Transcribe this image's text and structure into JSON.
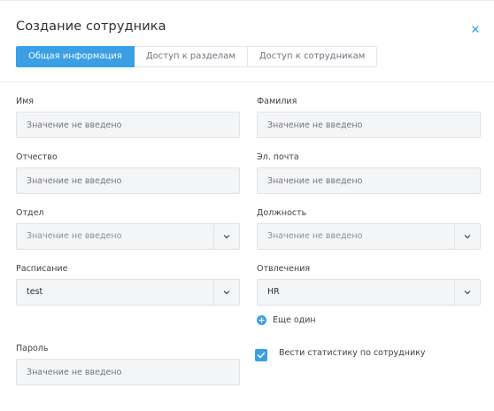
{
  "dialog": {
    "title": "Создание сотрудника",
    "close_icon": "close-icon"
  },
  "tabs": [
    {
      "label": "Общая информация",
      "active": true
    },
    {
      "label": "Доступ к разделам",
      "active": false
    },
    {
      "label": "Доступ к сотрудникам",
      "active": false
    }
  ],
  "form": {
    "first_name": {
      "label": "Имя",
      "placeholder": "Значение не введено",
      "value": ""
    },
    "last_name": {
      "label": "Фамилия",
      "placeholder": "Значение не введено",
      "value": ""
    },
    "middle_name": {
      "label": "Отчество",
      "placeholder": "Значение не введено",
      "value": ""
    },
    "email": {
      "label": "Эл. почта",
      "placeholder": "Значение не введено",
      "value": ""
    },
    "department": {
      "label": "Отдел",
      "display": "Значение не введено"
    },
    "position": {
      "label": "Должность",
      "display": "Значение не введено"
    },
    "schedule": {
      "label": "Расписание",
      "display": "test"
    },
    "distractions": {
      "label": "Отвлечения",
      "display": "HR"
    },
    "add_one": {
      "label": "Еще один"
    },
    "password": {
      "label": "Пароль",
      "placeholder": "Значение не введено",
      "value": ""
    },
    "track_stats": {
      "label": "Вести статистику по сотруднику",
      "checked": true
    }
  },
  "colors": {
    "accent": "#3b9fe6",
    "field_bg": "#f4f5f7",
    "border": "#e1e3e7"
  }
}
